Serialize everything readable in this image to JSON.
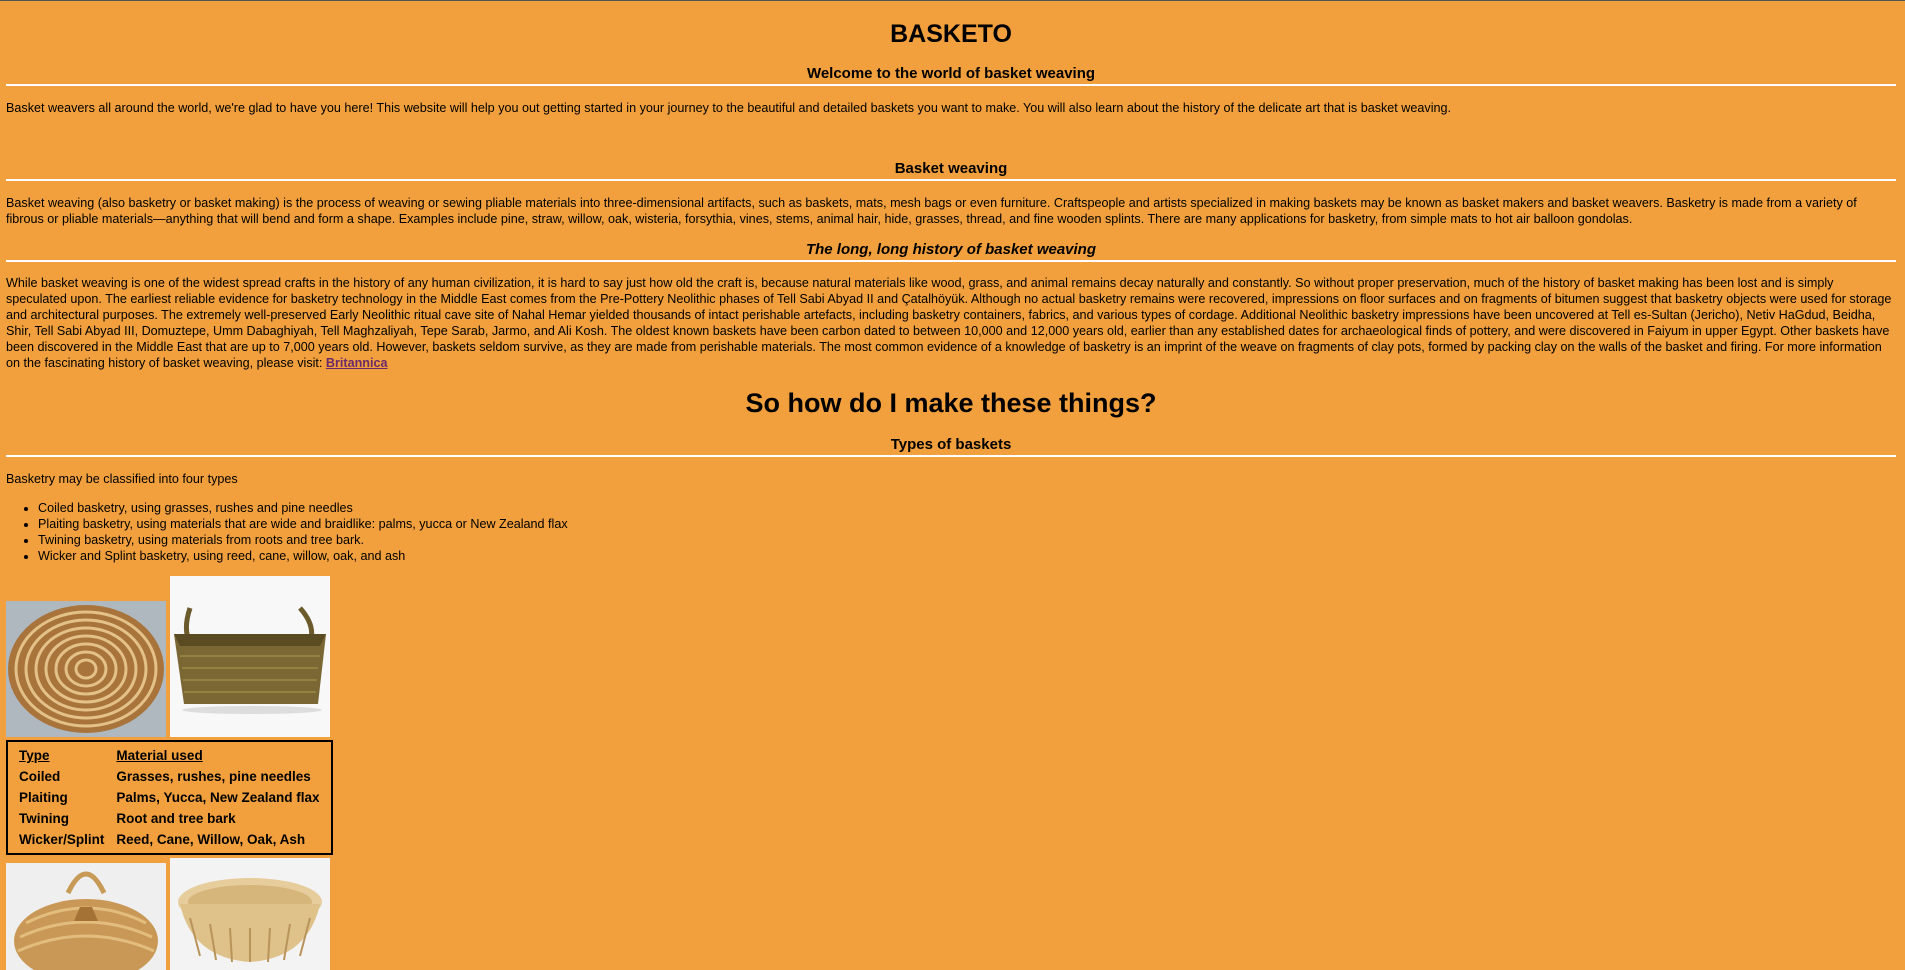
{
  "header": {
    "title": "BASKETO"
  },
  "welcome": {
    "heading": "Welcome to the world of basket weaving",
    "text": "Basket weavers all around the world, we're glad to have you here! This website will help you out getting started in your journey to the beautiful and detailed baskets you want to make. You will also learn about the history of the delicate art that is basket weaving."
  },
  "basket_weaving": {
    "heading": "Basket weaving",
    "text": "Basket weaving (also basketry or basket making) is the process of weaving or sewing pliable materials into three-dimensional artifacts, such as baskets, mats, mesh bags or even furniture. Craftspeople and artists specialized in making baskets may be known as basket makers and basket weavers. Basketry is made from a variety of fibrous or pliable materials—anything that will bend and form a shape. Examples include pine, straw, willow, oak, wisteria, forsythia, vines, stems, animal hair, hide, grasses, thread, and fine wooden splints. There are many applications for basketry, from simple mats to hot air balloon gondolas."
  },
  "history": {
    "heading": "The long, long history of basket weaving",
    "text": "While basket weaving is one of the widest spread crafts in the history of any human civilization, it is hard to say just how old the craft is, because natural materials like wood, grass, and animal remains decay naturally and constantly. So without proper preservation, much of the history of basket making has been lost and is simply speculated upon. The earliest reliable evidence for basketry technology in the Middle East comes from the Pre-Pottery Neolithic phases of Tell Sabi Abyad II and Çatalhöyük. Although no actual basketry remains were recovered, impressions on floor surfaces and on fragments of bitumen suggest that basketry objects were used for storage and architectural purposes. The extremely well-preserved Early Neolithic ritual cave site of Nahal Hemar yielded thousands of intact perishable artefacts, including basketry containers, fabrics, and various types of cordage. Additional Neolithic basketry impressions have been uncovered at Tell es-Sultan (Jericho), Netiv HaGdud, Beidha, Shir, Tell Sabi Abyad III, Domuztepe, Umm Dabaghiyah, Tell Maghzaliyah, Tepe Sarab, Jarmo, and Ali Kosh. The oldest known baskets have been carbon dated to between 10,000 and 12,000 years old, earlier than any established dates for archaeological finds of pottery, and were discovered in Faiyum in upper Egypt. Other baskets have been discovered in the Middle East that are up to 7,000 years old. However, baskets seldom survive, as they are made from perishable materials. The most common evidence of a knowledge of basketry is an imprint of the weave on fragments of clay pots, formed by packing clay on the walls of the basket and firing. For more information on the fascinating history of basket weaving, please visit: ",
    "link_label": "Britannica"
  },
  "howto": {
    "heading": "So how do I make these things?"
  },
  "types": {
    "heading": "Types of baskets",
    "intro": "Basketry may be classified into four types",
    "items": [
      "Coiled basketry, using grasses, rushes and pine needles",
      "Plaiting basketry, using materials that are wide and braidlike: palms, yucca or New Zealand flax",
      "Twining basketry, using materials from roots and tree bark.",
      "Wicker and Splint basketry, using reed, cane, willow, oak, and ash"
    ]
  },
  "table": {
    "headers": [
      "Type",
      "Material used"
    ],
    "rows": [
      [
        "Coiled",
        "Grasses, rushes, pine needles"
      ],
      [
        "Plaiting",
        "Palms, Yucca, New Zealand flax"
      ],
      [
        "Twining",
        "Root and tree bark"
      ],
      [
        "Wicker/Splint",
        "Reed, Cane, Willow, Oak, Ash"
      ]
    ]
  },
  "images": [
    "coiled-basket-photo",
    "plaited-basket-photo",
    "twined-basket-photo",
    "wicker-basket-photo"
  ],
  "colors": {
    "background": "#f2a03d",
    "rule": "#ffffff",
    "link": "#6a2a6a"
  }
}
